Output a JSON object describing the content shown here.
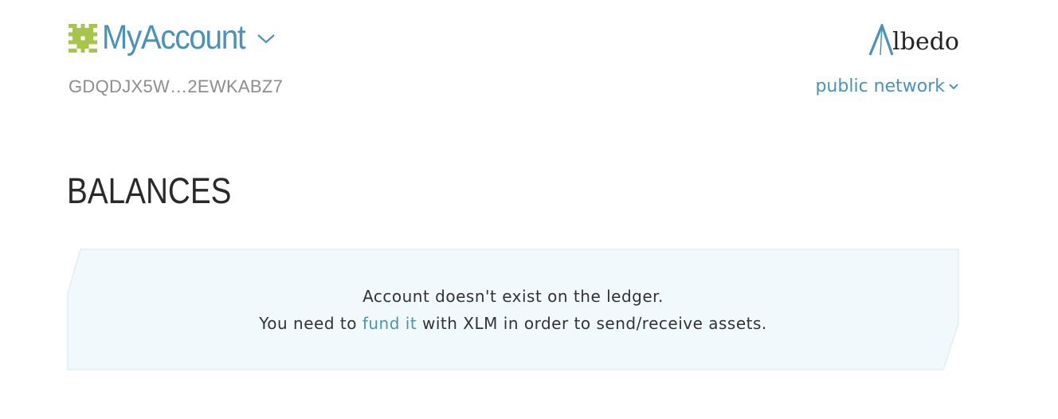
{
  "header": {
    "account_title": "MyAccount",
    "account_address": "GDQDJX5W…2EWKABZ7",
    "identicon_icon": "identicon",
    "brand_name": "lbedo",
    "network_label": "public network",
    "network_chevron_icon": "chevron-down-icon"
  },
  "balances": {
    "title": "BALANCES",
    "notice_line1": "Account doesn't exist on the ledger.",
    "notice_line2_prefix": "You need to ",
    "notice_link": "fund it",
    "notice_line2_suffix": " with XLM in order to send/receive assets."
  },
  "colors": {
    "accent": "#4a93b5",
    "identicon": "#a6c54a",
    "notice_bg": "#f2f9fc",
    "notice_border": "#e2edf2",
    "muted_text": "#8d8d8d"
  }
}
